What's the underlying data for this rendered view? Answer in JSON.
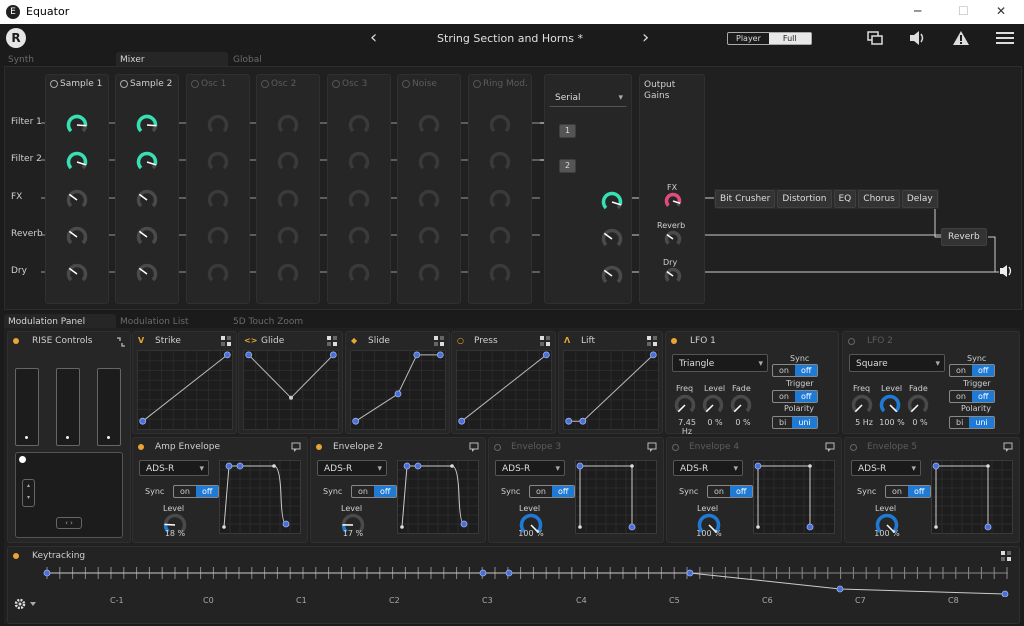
{
  "window": {
    "title": "Equator",
    "min": "─",
    "max": "☐",
    "close": "✕"
  },
  "header": {
    "preset": "String Section and Horns *",
    "prev": "‹",
    "next": "›",
    "mode_player": "Player",
    "mode_full": "Full"
  },
  "top_tabs": [
    "Synth",
    "Mixer",
    "Global"
  ],
  "rows": [
    "Filter 1",
    "Filter 2",
    "FX",
    "Reverb",
    "Dry"
  ],
  "mixer": {
    "channels": [
      {
        "name": "Sample 1",
        "active": true
      },
      {
        "name": "Sample 2",
        "active": true
      },
      {
        "name": "Osc 1",
        "active": false
      },
      {
        "name": "Osc 2",
        "active": false
      },
      {
        "name": "Osc 3",
        "active": false
      },
      {
        "name": "Noise",
        "active": false
      },
      {
        "name": "Ring Mod.",
        "active": false
      }
    ],
    "routing": "Serial",
    "routing_nodes": [
      "1",
      "2"
    ],
    "output_title": "Output Gains",
    "output_labels": [
      "FX",
      "Reverb",
      "Dry"
    ],
    "fx_chain": [
      "Bit Crusher",
      "Distortion",
      "EQ",
      "Chorus",
      "Delay"
    ],
    "reverb_button": "Reverb",
    "speaker_icon": "speaker-icon"
  },
  "bottom_tabs": [
    "Modulation Panel",
    "Modulation List",
    "5D Touch Zoom"
  ],
  "rise": {
    "title": "RISE Controls"
  },
  "mod_sources": [
    {
      "name": "Strike",
      "glyph": "V"
    },
    {
      "name": "Glide",
      "glyph": "<>"
    },
    {
      "name": "Slide",
      "glyph": "◆"
    },
    {
      "name": "Press",
      "glyph": "○"
    },
    {
      "name": "Lift",
      "glyph": "Λ"
    }
  ],
  "lfos": [
    {
      "name": "LFO 1",
      "active": true,
      "wave": "Triangle",
      "sync_on": "on",
      "sync_off": "off",
      "trigger_on": "on",
      "trigger_off": "off",
      "polarity_a": "bi",
      "polarity_b": "uni",
      "freq_label": "Freq",
      "level_label": "Level",
      "fade_label": "Fade",
      "freq": "7.45 Hz",
      "level": "0 %",
      "fade": "0 %",
      "sync": "Sync",
      "trigger": "Trigger",
      "polarity": "Polarity"
    },
    {
      "name": "LFO 2",
      "active": false,
      "wave": "Square",
      "sync_on": "on",
      "sync_off": "off",
      "trigger_on": "on",
      "trigger_off": "off",
      "polarity_a": "bi",
      "polarity_b": "uni",
      "freq_label": "Freq",
      "level_label": "Level",
      "fade_label": "Fade",
      "freq": "5 Hz",
      "level": "100 %",
      "fade": "0 %",
      "sync": "Sync",
      "trigger": "Trigger",
      "polarity": "Polarity"
    }
  ],
  "envelopes": [
    {
      "name": "Amp Envelope",
      "active": true,
      "mode": "ADS-R",
      "sync": "Sync",
      "on": "on",
      "off": "off",
      "level_label": "Level",
      "level": "18 %"
    },
    {
      "name": "Envelope 2",
      "active": true,
      "mode": "ADS-R",
      "sync": "Sync",
      "on": "on",
      "off": "off",
      "level_label": "Level",
      "level": "17 %"
    },
    {
      "name": "Envelope 3",
      "active": false,
      "mode": "ADS-R",
      "sync": "Sync",
      "on": "on",
      "off": "off",
      "level_label": "Level",
      "level": "100 %"
    },
    {
      "name": "Envelope 4",
      "active": false,
      "mode": "ADS-R",
      "sync": "Sync",
      "on": "on",
      "off": "off",
      "level_label": "Level",
      "level": "100 %"
    },
    {
      "name": "Envelope 5",
      "active": false,
      "mode": "ADS-R",
      "sync": "Sync",
      "on": "on",
      "off": "off",
      "level_label": "Level",
      "level": "100 %"
    }
  ],
  "keytracking": {
    "title": "Keytracking",
    "notes": [
      "C-1",
      "C0",
      "C1",
      "C2",
      "C3",
      "C4",
      "C5",
      "C6",
      "C7",
      "C8"
    ]
  },
  "colors": {
    "accent": "#35e0b4",
    "blue": "#1f7ad6",
    "orange": "#e8a534",
    "fx_pink": "#e24a7a"
  }
}
